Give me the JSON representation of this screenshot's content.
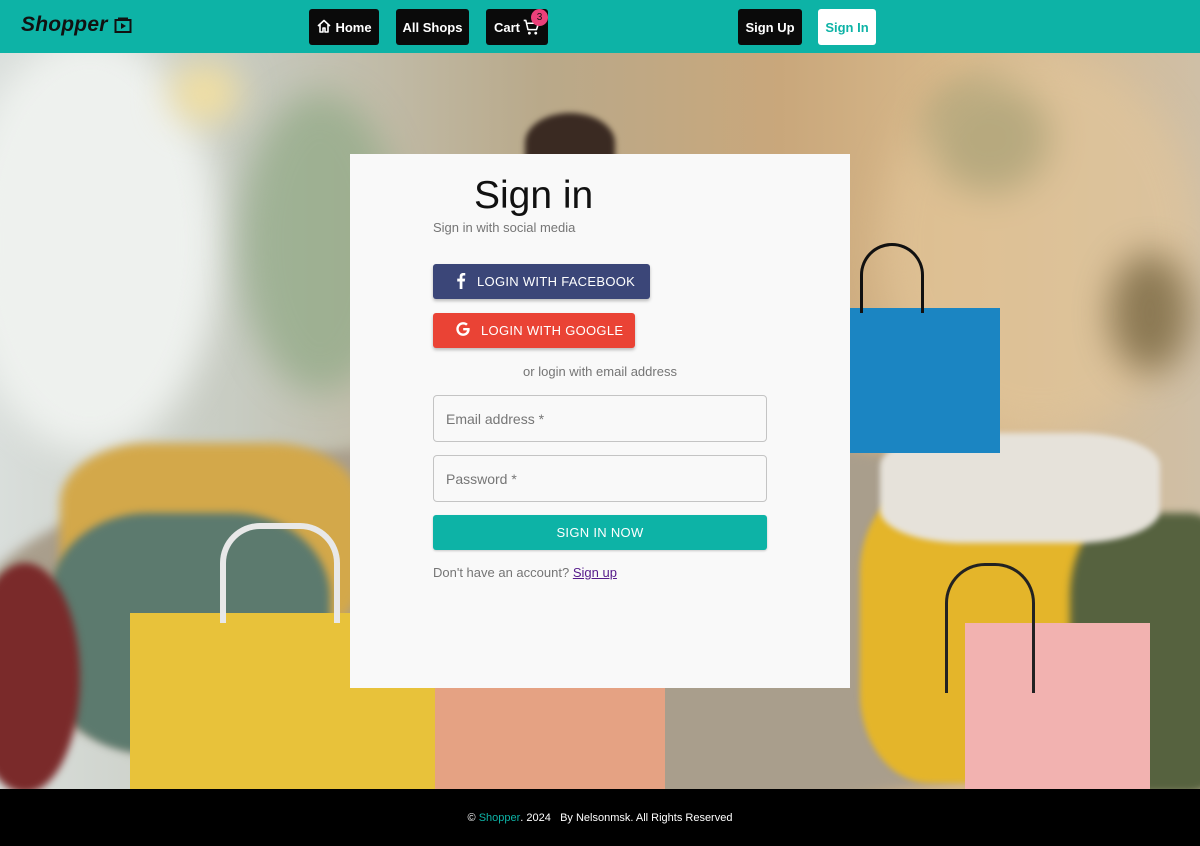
{
  "navbar": {
    "brand": "Shopper",
    "home_label": "Home",
    "shops_label": "All Shops",
    "cart_label": "Cart",
    "cart_count": "3",
    "signup_label": "Sign Up",
    "signin_label": "Sign In"
  },
  "signin": {
    "title": "Sign in",
    "subtitle": "Sign in with social media",
    "facebook_label": "LOGIN WITH FACEBOOK",
    "google_label": "LOGIN WITH GOOGLE",
    "or_text": "or login with email address",
    "email_placeholder": "Email address *",
    "password_placeholder": "Password *",
    "submit_label": "SIGN IN NOW",
    "no_account_text": "Don't have an account?",
    "signup_link": "Sign up"
  },
  "footer": {
    "copyright_symbol": "©",
    "brand": "Shopper",
    "year_text": ". 2024",
    "rights_text": "By Nelsonmsk. All Rights Reserved"
  },
  "colors": {
    "accent": "#0db3a6",
    "facebook": "#3b4678",
    "google": "#ea4335",
    "badge": "#ec407a"
  },
  "icons": [
    "video-library-icon",
    "home-icon",
    "cart-icon",
    "facebook-icon",
    "google-icon"
  ]
}
